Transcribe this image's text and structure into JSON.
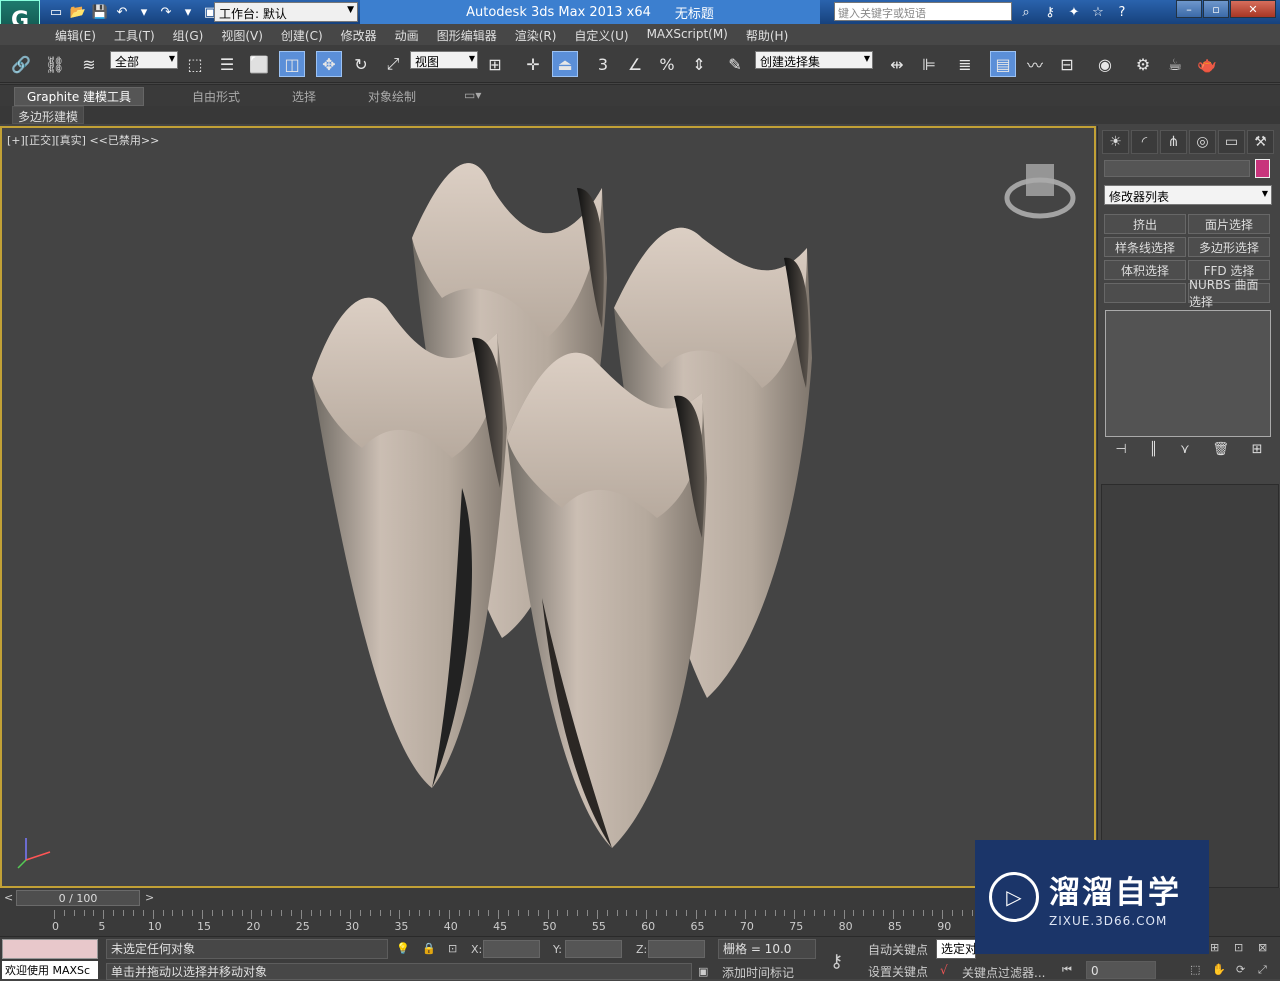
{
  "app": {
    "product": "Autodesk 3ds Max  2013 x64",
    "document": "无标题",
    "workspace_label": "工作台: 默认",
    "search_placeholder": "键入关键字或短语"
  },
  "menu": [
    "编辑(E)",
    "工具(T)",
    "组(G)",
    "视图(V)",
    "创建(C)",
    "修改器",
    "动画",
    "图形编辑器",
    "渲染(R)",
    "自定义(U)",
    "MAXScript(M)",
    "帮助(H)"
  ],
  "toolbar": {
    "selection_filter": "全部",
    "ref_coord": "视图",
    "named_selection": "创建选择集",
    "snap_num": "3"
  },
  "ribbon": {
    "tabs": [
      "Graphite 建模工具",
      "自由形式",
      "选择",
      "对象绘制"
    ],
    "subtab": "多边形建模"
  },
  "viewport": {
    "label": "[+][正交][真实] <<已禁用>>",
    "object_color": "#bfb2a6"
  },
  "command_panel": {
    "modifier_list": "修改器列表",
    "buttons": [
      "挤出",
      "面片选择",
      "样条线选择",
      "多边形选择",
      "体积选择",
      "FFD 选择",
      "",
      "NURBS 曲面选择"
    ],
    "name_color": "#c8347c"
  },
  "timeline": {
    "frame_display": "0 / 100",
    "ticks": [
      "0",
      "5",
      "10",
      "15",
      "20",
      "25",
      "30",
      "35",
      "40",
      "45",
      "50",
      "55",
      "60",
      "65",
      "70",
      "75",
      "80",
      "85",
      "90"
    ]
  },
  "status": {
    "listener": "欢迎使用 MAXSc",
    "selection": "未选定任何对象",
    "prompt": "单击并拖动以选择并移动对象",
    "x_label": "X:",
    "y_label": "Y:",
    "z_label": "Z:",
    "grid": "栅格 = 10.0",
    "auto_key": "自动关键点",
    "set_key": "设置关键点",
    "selected": "选定对",
    "add_time_tag": "添加时间标记",
    "key_filter": "关键点过滤器...",
    "frame": "0"
  },
  "watermark": {
    "title": "溜溜自学",
    "url": "ZIXUE.3D66.COM"
  }
}
